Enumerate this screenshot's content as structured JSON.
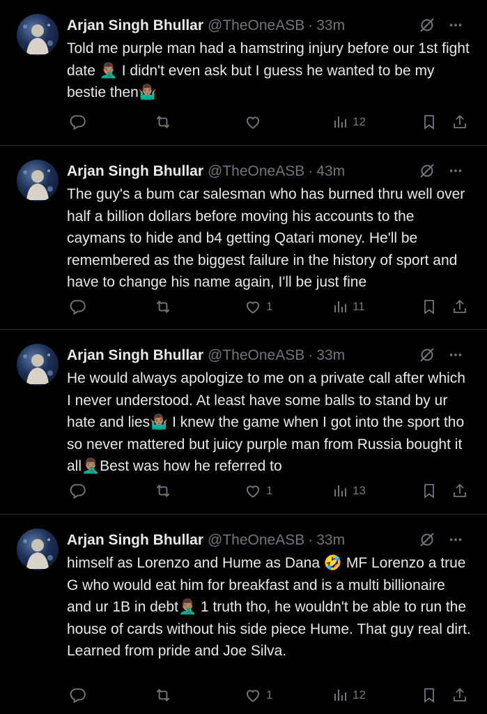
{
  "tweets": [
    {
      "author": "Arjan Singh Bhullar",
      "handle": "@TheOneASB",
      "separator": "·",
      "time": "33m",
      "text": "Told me purple man had a hamstring injury before our 1st fight date 🤦🏽‍♂️ I didn't even ask but I guess he wanted to be my bestie then🤷🏽‍♂️",
      "replies": "",
      "retweets": "",
      "likes": "",
      "views": "12"
    },
    {
      "author": "Arjan Singh Bhullar",
      "handle": "@TheOneASB",
      "separator": "·",
      "time": "43m",
      "text": "The guy's a bum car salesman who has burned thru well over half a billion dollars before moving his accounts to the caymans to hide and b4 getting Qatari money. He'll be remembered as the biggest failure in the history of sport and have to change his name again, I'll be just fine",
      "replies": "",
      "retweets": "",
      "likes": "1",
      "views": "11"
    },
    {
      "author": "Arjan Singh Bhullar",
      "handle": "@TheOneASB",
      "separator": "·",
      "time": "33m",
      "text": "He would always apologize to me on a private call after which I never understood. At least have some balls to stand by ur hate and lies🤷🏽‍♂️ I knew the game when I got into the sport tho so never mattered but juicy purple man from Russia bought it all🤦🏽‍♂️Best was how he referred to",
      "replies": "",
      "retweets": "",
      "likes": "1",
      "views": "13"
    },
    {
      "author": "Arjan Singh Bhullar",
      "handle": "@TheOneASB",
      "separator": "·",
      "time": "33m",
      "text": "himself as Lorenzo and Hume as Dana 🤣 MF Lorenzo a true G who would eat him for breakfast and is a multi billionaire and ur 1B in debt🤦🏽‍♂️ 1 truth tho, he wouldn't be able to run the house of cards without his side piece Hume. That guy real dirt. Learned from pride and Joe Silva.",
      "replies": "",
      "retweets": "",
      "likes": "1",
      "views": "12"
    }
  ],
  "icons": {
    "reply": "reply-icon",
    "retweet": "retweet-icon",
    "like": "heart-icon",
    "views": "views-icon",
    "bookmark": "bookmark-icon",
    "share": "share-icon",
    "grok": "grok-icon",
    "more": "more-icon"
  },
  "colors": {
    "background": "#000000",
    "text": "#e7e9ea",
    "muted": "#71767b",
    "divider": "#2f3336"
  }
}
